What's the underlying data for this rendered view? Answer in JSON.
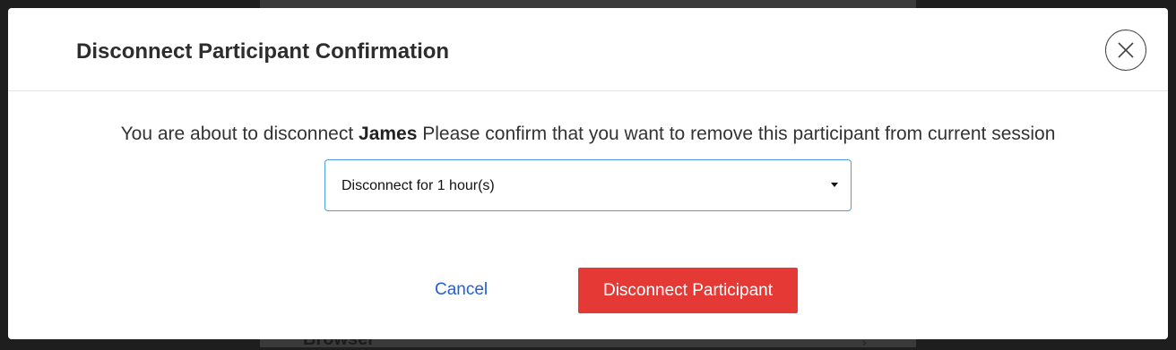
{
  "background": {
    "partial_text": "Browser",
    "chevron": "›"
  },
  "modal": {
    "title": "Disconnect Participant Confirmation",
    "close_icon": "close-icon",
    "message_prefix": "You are about to disconnect",
    "participant_name": "James",
    "message_suffix": "Please confirm that you want to remove this participant from current session",
    "duration_select": {
      "selected": "Disconnect for 1 hour(s)"
    },
    "cancel_label": "Cancel",
    "confirm_label": "Disconnect Participant"
  },
  "colors": {
    "danger": "#e53935",
    "link": "#1f5fd8",
    "focus_border": "#4a9fe0"
  }
}
